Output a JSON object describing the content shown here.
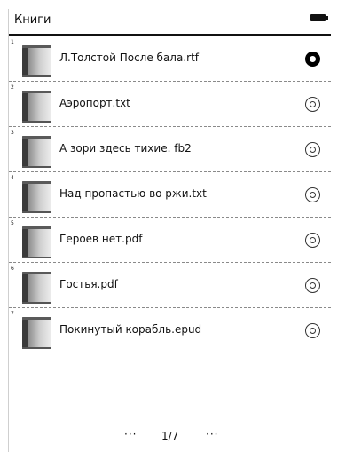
{
  "header": {
    "title": "Книги",
    "battery_icon": "battery-full-icon"
  },
  "books": [
    {
      "number": "1",
      "title": "Л.Толстой После бала.rtf",
      "selected": true
    },
    {
      "number": "2",
      "title": "Аэропорт.txt",
      "selected": false
    },
    {
      "number": "3",
      "title": "А зори здесь тихие. fb2",
      "selected": false
    },
    {
      "number": "4",
      "title": "Над пропастью во ржи.txt",
      "selected": false
    },
    {
      "number": "5",
      "title": "Героев нет.pdf",
      "selected": false
    },
    {
      "number": "6",
      "title": "Гостья.pdf",
      "selected": false
    },
    {
      "number": "7",
      "title": "Покинутый корабль.epud",
      "selected": false
    }
  ],
  "pager": {
    "prev": "···",
    "page": "1/7",
    "next": "···"
  }
}
